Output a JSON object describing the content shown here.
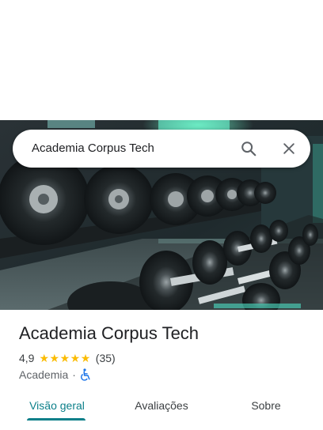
{
  "search": {
    "query": "Academia Corpus Tech",
    "search_icon": "search-icon",
    "close_icon": "close-icon"
  },
  "hero_image": {
    "subject": "dumbbell-rack-photo"
  },
  "place": {
    "title": "Academia Corpus Tech",
    "rating": "4,9",
    "stars": 5,
    "review_count": "(35)",
    "category": "Academia",
    "separator": "·",
    "accessibility_icon": "wheelchair-icon"
  },
  "tabs": [
    {
      "label": "Visão geral",
      "active": true
    },
    {
      "label": "Avaliações",
      "active": false
    },
    {
      "label": "Sobre",
      "active": false
    }
  ],
  "colors": {
    "accent": "#0b7f89",
    "star": "#fbbc04",
    "accessibility": "#1a73e8"
  }
}
